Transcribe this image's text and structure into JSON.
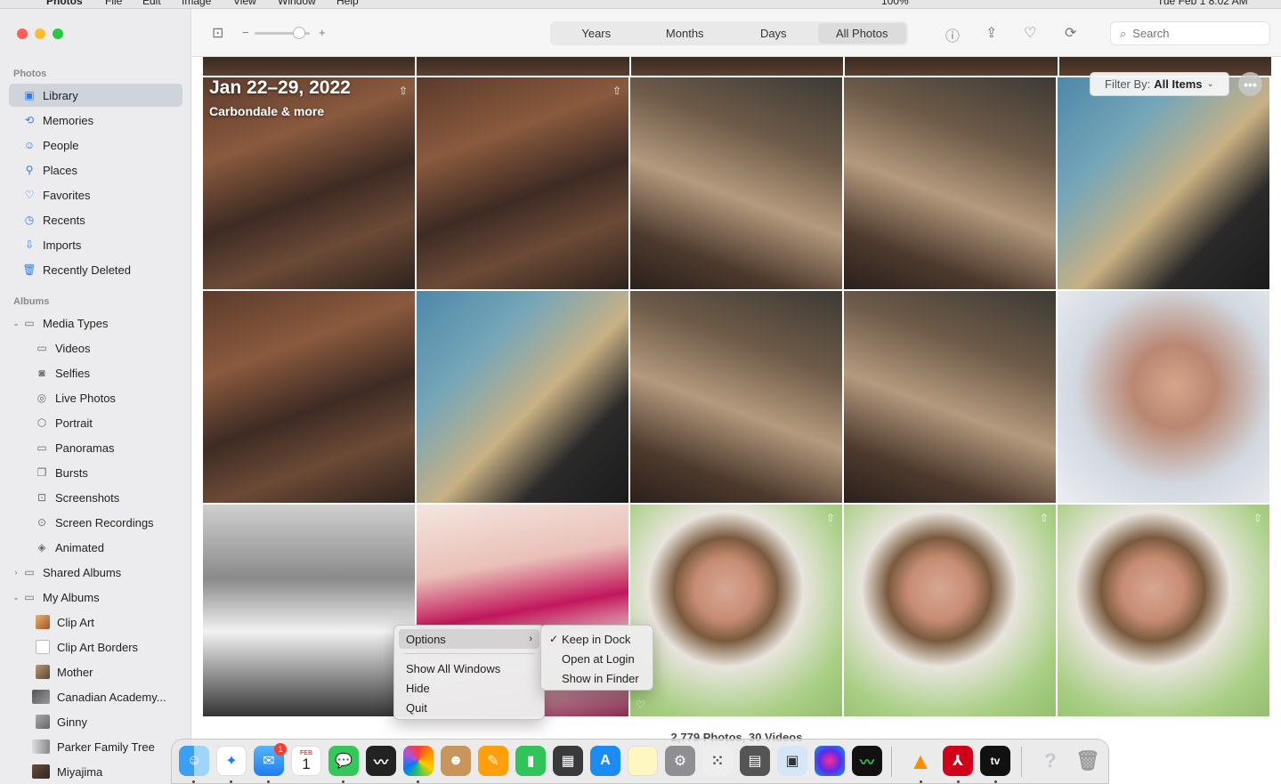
{
  "menubar": {
    "items": [
      "Photos",
      "File",
      "Edit",
      "Image",
      "View",
      "Window",
      "Help"
    ],
    "battery": "100%",
    "clock": "Tue Feb 1 8:02 AM"
  },
  "sidebar": {
    "photos_header": "Photos",
    "photos_items": [
      {
        "label": "Library"
      },
      {
        "label": "Memories"
      },
      {
        "label": "People"
      },
      {
        "label": "Places"
      },
      {
        "label": "Favorites"
      },
      {
        "label": "Recents"
      },
      {
        "label": "Imports"
      },
      {
        "label": "Recently Deleted"
      }
    ],
    "albums_header": "Albums",
    "media_types": "Media Types",
    "media_items": [
      {
        "label": "Videos"
      },
      {
        "label": "Selfies"
      },
      {
        "label": "Live Photos"
      },
      {
        "label": "Portrait"
      },
      {
        "label": "Panoramas"
      },
      {
        "label": "Bursts"
      },
      {
        "label": "Screenshots"
      },
      {
        "label": "Screen Recordings"
      },
      {
        "label": "Animated"
      }
    ],
    "shared_albums": "Shared Albums",
    "my_albums": "My Albums",
    "my_album_items": [
      {
        "label": "Clip Art"
      },
      {
        "label": "Clip Art Borders"
      },
      {
        "label": "Mother"
      },
      {
        "label": "Canadian Academy..."
      },
      {
        "label": "Ginny"
      },
      {
        "label": "Parker Family Tree"
      },
      {
        "label": "Miyajima"
      }
    ]
  },
  "toolbar": {
    "zoom_minus": "−",
    "zoom_plus": "+",
    "segments": [
      "Years",
      "Months",
      "Days",
      "All Photos"
    ],
    "active_segment": "All Photos",
    "search_placeholder": "Search"
  },
  "grid": {
    "date_title": "Jan 22–29, 2022",
    "date_subtitle": "Carbondale & more",
    "filter_label": "Filter By:",
    "filter_value": "All Items",
    "counts": "2,779 Photos, 30 Videos"
  },
  "context_menu": {
    "items": [
      "Options",
      "Show All Windows",
      "Hide",
      "Quit"
    ],
    "submenu": [
      "Keep in Dock",
      "Open at Login",
      "Show in Finder"
    ],
    "checked": "Keep in Dock"
  },
  "dock": {
    "mail_badge": "1",
    "calendar_month": "FEB",
    "calendar_day": "1",
    "tv_label": "tv"
  },
  "colors": {
    "accent": "#2b7cf6",
    "sidebar_bg": "#ececee",
    "selected_bg": "#cfd3da",
    "close": "#ff5f57",
    "minimize": "#febc2e",
    "zoom": "#28c840"
  }
}
